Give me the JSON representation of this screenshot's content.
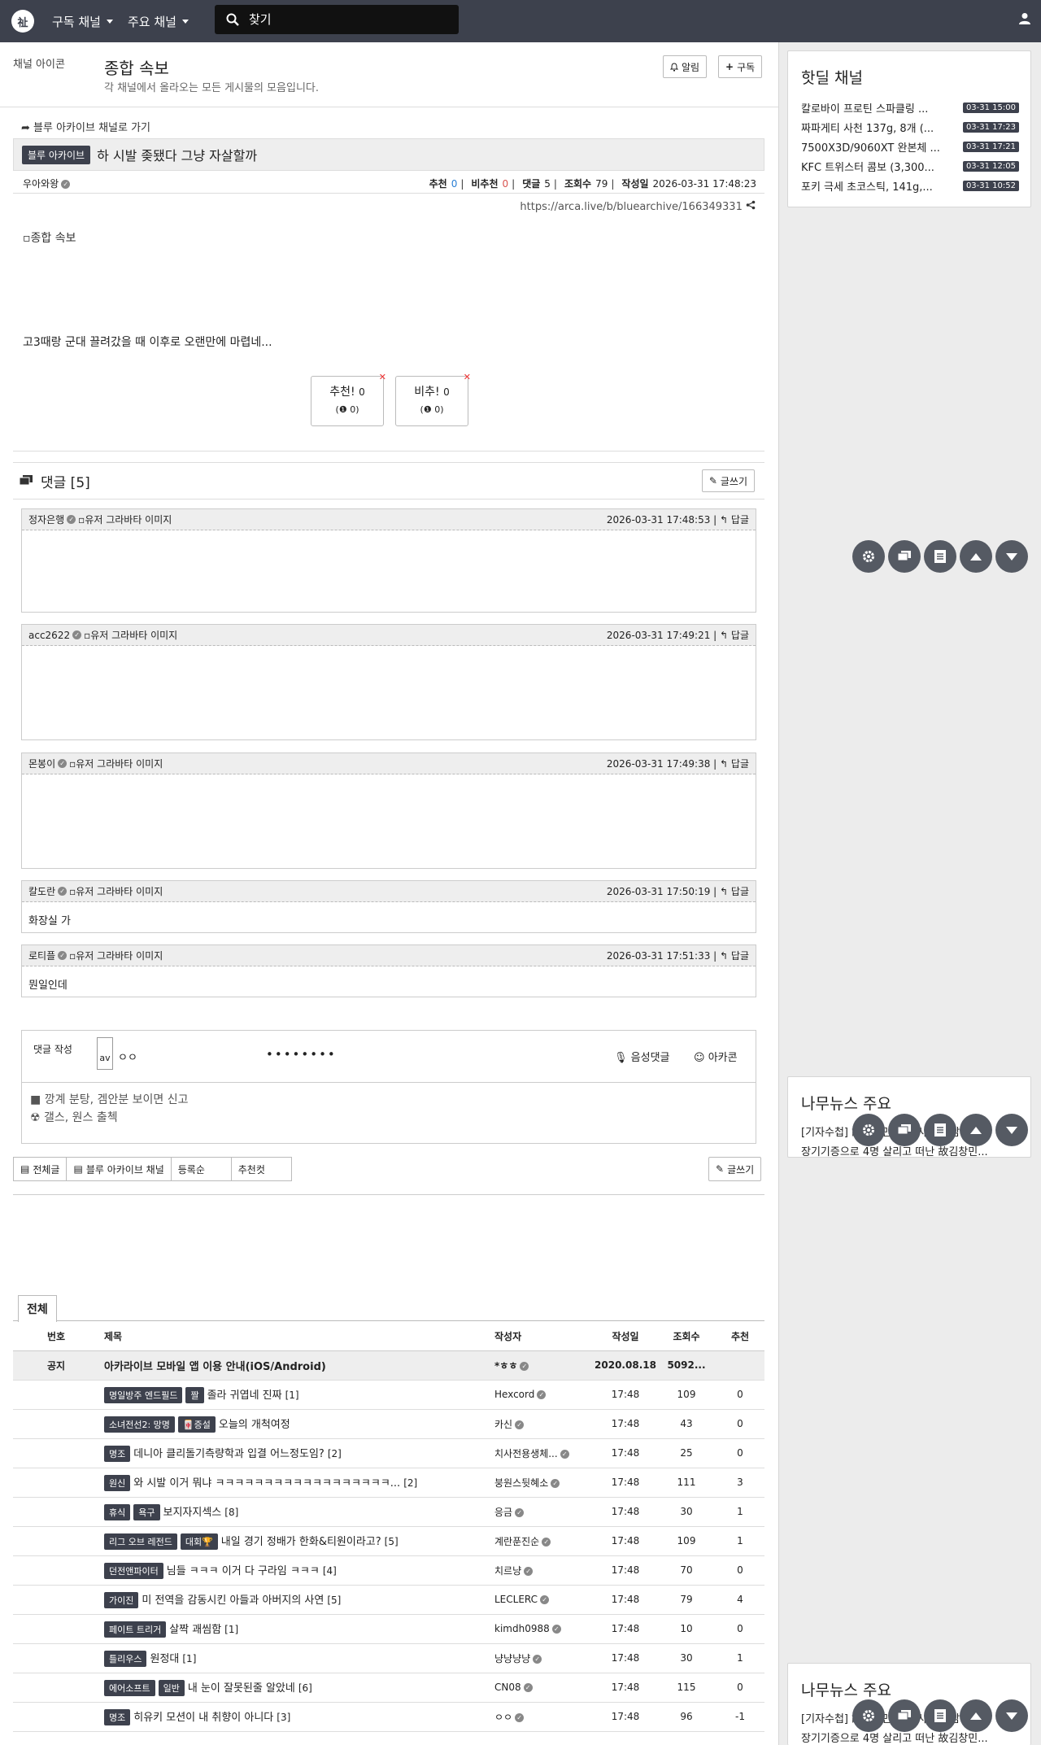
{
  "nav": {
    "logo": "祉",
    "menu_subscribed": "구독 채널",
    "menu_main": "주요 채널",
    "search_placeholder": "찾기"
  },
  "channel": {
    "icon_alt": "채널 아이콘",
    "title": "종합 속보",
    "description": "각 채널에서 올라오는 모든 게시물의 모음입니다.",
    "alarm_label": "알림",
    "subscribe_label": "구독"
  },
  "post": {
    "back_link": "블루 아카이브 채널로 가기",
    "badge": "블루 아카이브",
    "title": "하 시발 좆됐다 그냥 자살할까",
    "author": "우아와왕",
    "label_up": "추천",
    "up": "0",
    "label_down": "비추천",
    "down": "0",
    "label_comments": "댓글",
    "comments": "5",
    "label_views": "조회수",
    "views": "79",
    "label_date": "작성일",
    "date": "2026-03-31 17:48:23",
    "url": "https://arca.live/b/bluearchive/166349331",
    "image_alt": "종합 속보",
    "body": "고3때랑 군대 끌려갔을 때 이후로 오랜만에 마렵네...",
    "vote_up_label": "추천!",
    "vote_up_count": "0",
    "vote_up_sub": "0",
    "vote_down_label": "비추!",
    "vote_down_count": "0",
    "vote_down_sub": "0"
  },
  "comments_section": {
    "title": "댓글 [5]",
    "write_label": "글쓰기",
    "reply_label": "답글",
    "avatar_alt": "유저 그라바타 이미지",
    "items": [
      {
        "author": "정자은행",
        "date": "2026-03-31 17:48:53",
        "text": ""
      },
      {
        "author": "acc2622",
        "date": "2026-03-31 17:49:21",
        "text": ""
      },
      {
        "author": "몬봉이",
        "date": "2026-03-31 17:49:38",
        "text": ""
      },
      {
        "author": "칼도란",
        "date": "2026-03-31 17:50:19",
        "text": "화장실 가"
      },
      {
        "author": "로티플",
        "date": "2026-03-31 17:51:33",
        "text": "뭔일인데"
      }
    ]
  },
  "write": {
    "label": "댓글 작성",
    "avatar": "av",
    "name": "ㅇㅇ",
    "password": "••••••••",
    "voice_label": "음성댓글",
    "emoticon_label": "아카콘",
    "line1": "깡계 분탕, 겜안분 보이면 신고",
    "line2": "갤스, 원스 출첵"
  },
  "filters": {
    "all": "전체글",
    "channel": "블루 아카이브 채널",
    "sort": "등록순",
    "recommend": "추천컷",
    "write": "글쓰기"
  },
  "list": {
    "tab": "전체",
    "headers": [
      "번호",
      "제목",
      "작성자",
      "작성일",
      "조회수",
      "추천"
    ],
    "notice": {
      "no": "공지",
      "title": "아카라이브 모바일 앱 이용 안내(iOS/Android)",
      "author": "*ㅎㅎ",
      "date": "2020.08.18",
      "views": "5092...",
      "rec": ""
    },
    "rows": [
      {
        "b1": "명일방주 엔드필드",
        "b2": "짤",
        "title": "졸라 귀엽네 진짜",
        "cc": "[1]",
        "author": "Hexcord",
        "date": "17:48",
        "views": "109",
        "rec": "0"
      },
      {
        "b1": "소녀전선2: 망명",
        "b2": "🀄증설",
        "title": "오늘의 개척여정",
        "cc": "",
        "author": "카신",
        "date": "17:48",
        "views": "43",
        "rec": "0"
      },
      {
        "b1": "명조",
        "b2": "",
        "title": "데니아 클리돌기측량학과 입결 어느정도임?",
        "cc": "[2]",
        "author": "치사전용생체...",
        "date": "17:48",
        "views": "25",
        "rec": "0"
      },
      {
        "b1": "원신",
        "b2": "",
        "title": "와 시발 이거 뭐냐 ㅋㅋㅋㅋㅋㅋㅋㅋㅋㅋㅋㅋㅋㅋㅋㅋㅋㅋ...",
        "cc": "[2]",
        "author": "붕원스뒷혜소",
        "date": "17:48",
        "views": "111",
        "rec": "3"
      },
      {
        "b1": "휴식",
        "b2": "욕구",
        "title": "보지자지섹스",
        "cc": "[8]",
        "author": "응금",
        "date": "17:48",
        "views": "30",
        "rec": "1"
      },
      {
        "b1": "리그 오브 레전드",
        "b2": "대회🏆",
        "title": "내일 경기 정배가 한화&티원이라고?",
        "cc": "[5]",
        "author": "계란푼진순",
        "date": "17:48",
        "views": "109",
        "rec": "1"
      },
      {
        "b1": "던전앤파이터",
        "b2": "",
        "title": "님들 ㅋㅋㅋ 이거 다 구라임 ㅋㅋㅋ",
        "cc": "[4]",
        "author": "치르냥",
        "date": "17:48",
        "views": "70",
        "rec": "0"
      },
      {
        "b1": "가이진",
        "b2": "",
        "title": "미 전역을 감동시킨 아들과 아버지의 사연",
        "cc": "[5]",
        "author": "LECLERC",
        "date": "17:48",
        "views": "79",
        "rec": "4"
      },
      {
        "b1": "페이트 트리거",
        "b2": "",
        "title": "살짝 괘씸함",
        "cc": "[1]",
        "author": "kimdh0988",
        "date": "17:48",
        "views": "10",
        "rec": "0"
      },
      {
        "b1": "틀리우스",
        "b2": "",
        "title": "원정대",
        "cc": "[1]",
        "author": "냥냥냥냥",
        "date": "17:48",
        "views": "30",
        "rec": "1"
      },
      {
        "b1": "에어소프트",
        "b2": "일반",
        "title": "내 눈이 잘못된줄 알았네",
        "cc": "[6]",
        "author": "CN08",
        "date": "17:48",
        "views": "115",
        "rec": "0"
      },
      {
        "b1": "명조",
        "b2": "",
        "title": "히유키 모션이 내 취향이 아니다",
        "cc": "[3]",
        "author": "ㅇㅇ",
        "date": "17:48",
        "views": "96",
        "rec": "-1"
      }
    ]
  },
  "sidebar": {
    "hotdeal_title": "핫딜 채널",
    "hotdeals": [
      {
        "name": "칼로바이 프로틴 스파클링 ...",
        "time": "03-31 15:00"
      },
      {
        "name": "짜파게티 사천 137g, 8개 (...",
        "time": "03-31 17:23"
      },
      {
        "name": "7500X3D/9060XT 완본체 ...",
        "time": "03-31 17:21"
      },
      {
        "name": "KFC 트위스터 콤보 (3,300...",
        "time": "03-31 12:05"
      },
      {
        "name": "포키 극세 초코스틱, 141g,...",
        "time": "03-31 10:52"
      }
    ],
    "news_title": "나무뉴스 주요",
    "news": [
      "[기자수첩] 故김창민 감독 사건이 남긴 것",
      "장기기증으로 4명 살리고 떠난 故김창민..."
    ]
  }
}
